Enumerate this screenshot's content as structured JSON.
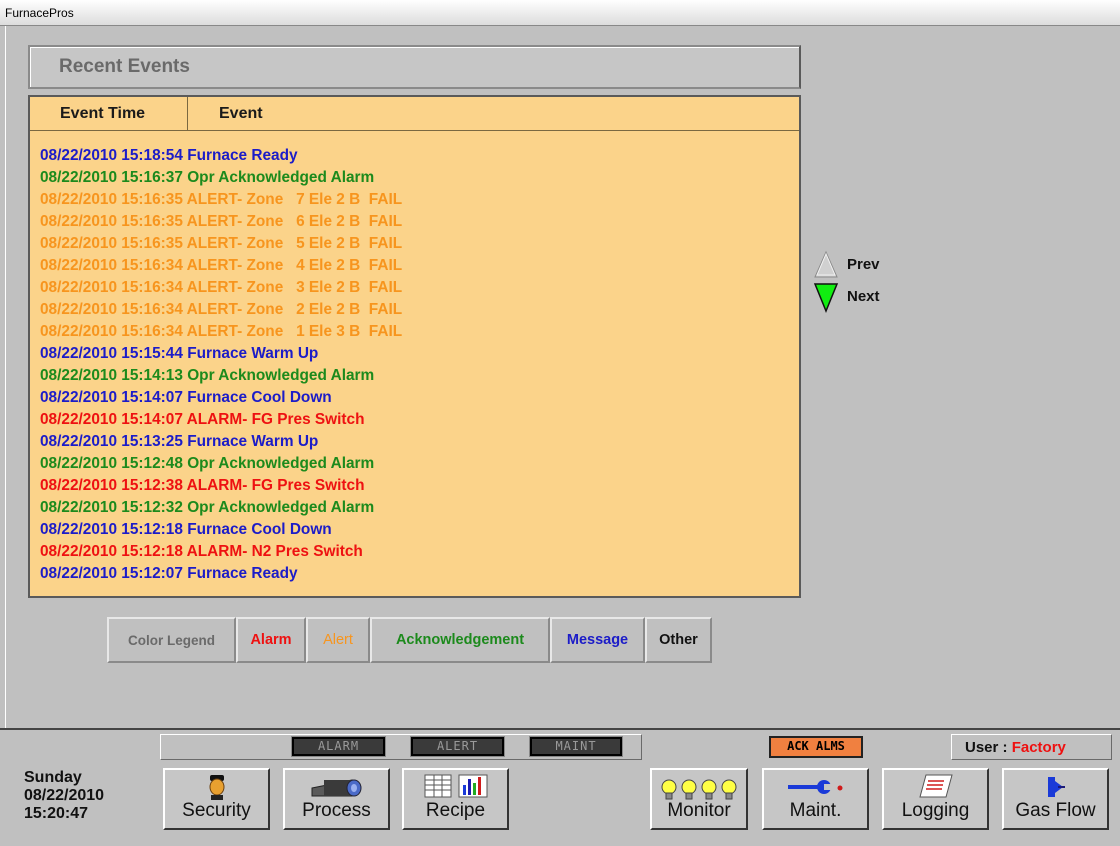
{
  "app": {
    "title": "FurnacePros"
  },
  "panel": {
    "title": "Recent Events",
    "col_time": "Event Time",
    "col_event": "Event"
  },
  "colors": {
    "alarm": "#ee1111",
    "alert": "#f7951e",
    "acknowledgement": "#1c8a1c",
    "message": "#1c1cc8",
    "events_background": "#fbd38a"
  },
  "events": [
    {
      "time": "08/22/2010 15:18:54",
      "text": "Furnace Ready",
      "type": "message"
    },
    {
      "time": "08/22/2010 15:16:37",
      "text": "Opr Acknowledged Alarm",
      "type": "ack"
    },
    {
      "time": "08/22/2010 15:16:35",
      "text": "ALERT- Zone   7 Ele 2 B  FAIL",
      "type": "alert"
    },
    {
      "time": "08/22/2010 15:16:35",
      "text": "ALERT- Zone   6 Ele 2 B  FAIL",
      "type": "alert"
    },
    {
      "time": "08/22/2010 15:16:35",
      "text": "ALERT- Zone   5 Ele 2 B  FAIL",
      "type": "alert"
    },
    {
      "time": "08/22/2010 15:16:34",
      "text": "ALERT- Zone   4 Ele 2 B  FAIL",
      "type": "alert"
    },
    {
      "time": "08/22/2010 15:16:34",
      "text": "ALERT- Zone   3 Ele 2 B  FAIL",
      "type": "alert"
    },
    {
      "time": "08/22/2010 15:16:34",
      "text": "ALERT- Zone   2 Ele 2 B  FAIL",
      "type": "alert"
    },
    {
      "time": "08/22/2010 15:16:34",
      "text": "ALERT- Zone   1 Ele 3 B  FAIL",
      "type": "alert"
    },
    {
      "time": "08/22/2010 15:15:44",
      "text": "Furnace Warm Up",
      "type": "message"
    },
    {
      "time": "08/22/2010 15:14:13",
      "text": "Opr Acknowledged Alarm",
      "type": "ack"
    },
    {
      "time": "08/22/2010 15:14:07",
      "text": "Furnace Cool Down",
      "type": "message"
    },
    {
      "time": "08/22/2010 15:14:07",
      "text": "ALARM- FG Pres Switch",
      "type": "alarm"
    },
    {
      "time": "08/22/2010 15:13:25",
      "text": "Furnace Warm Up",
      "type": "message"
    },
    {
      "time": "08/22/2010 15:12:48",
      "text": "Opr Acknowledged Alarm",
      "type": "ack"
    },
    {
      "time": "08/22/2010 15:12:38",
      "text": "ALARM- FG Pres Switch",
      "type": "alarm"
    },
    {
      "time": "08/22/2010 15:12:32",
      "text": "Opr Acknowledged Alarm",
      "type": "ack"
    },
    {
      "time": "08/22/2010 15:12:18",
      "text": "Furnace Cool Down",
      "type": "message"
    },
    {
      "time": "08/22/2010 15:12:18",
      "text": "ALARM- N2 Pres Switch",
      "type": "alarm"
    },
    {
      "time": "08/22/2010 15:12:07",
      "text": "Furnace Ready",
      "type": "message"
    }
  ],
  "nav": {
    "prev": "Prev",
    "next": "Next"
  },
  "legend": {
    "title": "Color Legend",
    "alarm": "Alarm",
    "alert": "Alert",
    "acknowledgement": "Acknowledgement",
    "message": "Message",
    "other": "Other"
  },
  "status": {
    "alarm": "ALARM",
    "alert": "ALERT",
    "maint": "MAINT",
    "ack_alms": "ACK ALMS",
    "user_label": "User :",
    "user_name": "Factory"
  },
  "datetime": {
    "day": "Sunday",
    "date": "08/22/2010",
    "time": "15:20:47"
  },
  "buttons": {
    "security": "Security",
    "process": "Process",
    "recipe": "Recipe",
    "monitor": "Monitor",
    "maint": "Maint.",
    "logging": "Logging",
    "gas_flow": "Gas Flow"
  }
}
